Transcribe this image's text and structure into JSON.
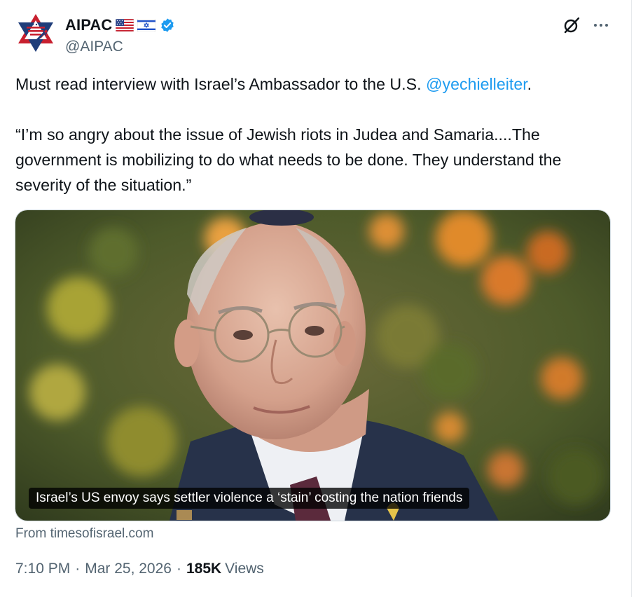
{
  "account": {
    "display_name": "AIPAC",
    "handle": "@AIPAC",
    "verified": true,
    "flags": [
      "us-flag-icon",
      "israel-flag-icon"
    ]
  },
  "tweet": {
    "line1_text": "Must read interview with Israel’s Ambassador to the U.S.",
    "mention": "@yechielleiter",
    "line1_end": ".",
    "quote": "“I’m so angry about the issue of Jewish riots in Judea and Samaria....The government is mobilizing to do what needs to be done. They understand the severity of the situation.”"
  },
  "card": {
    "caption": "Israel’s US envoy says settler violence a ‘stain’ costing the nation friends",
    "source": "From timesofisrael.com"
  },
  "meta": {
    "time": "7:10 PM",
    "date": "Mar 25, 2026",
    "separator": "·",
    "views_count": "185K",
    "views_label": "Views"
  },
  "colors": {
    "text": "#0f1419",
    "secondary": "#536471",
    "link": "#1d9bf0",
    "verified": "#1d9bf0"
  }
}
